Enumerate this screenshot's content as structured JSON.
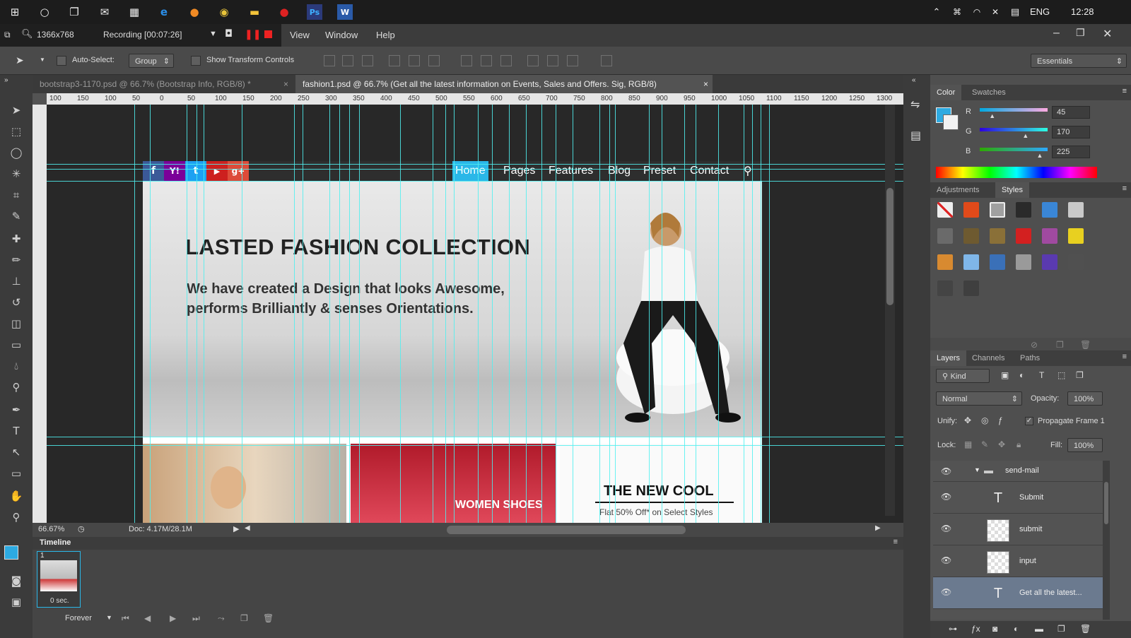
{
  "taskbar": {
    "icons": [
      "windows-icon",
      "cortana-icon",
      "task-view-icon",
      "mail-icon",
      "store-icon",
      "edge-icon",
      "firefox-icon",
      "chrome-icon",
      "explorer-icon",
      "record-icon",
      "photoshop-icon",
      "word-icon"
    ],
    "lang": "ENG",
    "time": "12:28"
  },
  "recorder": {
    "resolution": "1366x768",
    "recording": "Recording [00:07:26]"
  },
  "menu": {
    "items": [
      "View",
      "Window",
      "Help"
    ]
  },
  "options": {
    "auto_select": "Auto-Select:",
    "group": "Group",
    "show_transform": "Show Transform Controls",
    "workspace": "Essentials"
  },
  "tabs": [
    {
      "label": "bootstrap3-1170.psd @ 66.7% (Bootstrap Info, RGB/8) *"
    },
    {
      "label": "fashion1.psd @ 66.7% (Get all the latest information on Events, Sales and Offers. Sig, RGB/8)"
    }
  ],
  "ruler_h": [
    "100",
    "150",
    "100",
    "50",
    "0",
    "50",
    "100",
    "150",
    "200",
    "250",
    "300",
    "350",
    "400",
    "450",
    "500",
    "550",
    "600",
    "650",
    "700",
    "750",
    "800",
    "850",
    "900",
    "950",
    "1000",
    "1050",
    "1100",
    "1150",
    "1200",
    "1250",
    "1300"
  ],
  "design": {
    "nav": [
      "Home",
      "Pages",
      "Features",
      "Blog",
      "Preset",
      "Contact"
    ],
    "social": [
      "f",
      "Y!",
      "t",
      "▶",
      "g+"
    ],
    "hero_title": "LASTED FASHION COLLECTION",
    "hero_line1": "We have created a Design that looks Awesome,",
    "hero_line2": "performs Brilliantly & senses Orientations.",
    "promo_shoes": "WOMEN SHOES",
    "promo_cool": "THE NEW COOL",
    "promo_cool_sub": "Flat 50% Off* on Select Styles"
  },
  "status": {
    "zoom": "66.67%",
    "doc": "Doc: 4.17M/28.1M"
  },
  "timeline": {
    "title": "Timeline",
    "frame_num": "1",
    "frame_delay": "0 sec.",
    "loop": "Forever"
  },
  "color_panel": {
    "tabs": [
      "Color",
      "Swatches"
    ],
    "r": "45",
    "g": "170",
    "b": "225",
    "r_frac": 0.18,
    "g_frac": 0.67,
    "b_frac": 0.88,
    "fg_color": "#2daae1"
  },
  "styles_panel": {
    "tabs": [
      "Adjustments",
      "Styles"
    ],
    "swatches": [
      "#d8d8d8",
      "#e14a1a",
      "#a0a0a0",
      "#2a2a2a",
      "#3a86d6",
      "#c9c9c9",
      "#6a6a6a",
      "#6e5a30",
      "#8a7038",
      "#d32020",
      "#a04aa0",
      "#e8d020",
      "#d88a30",
      "#7fb6e8",
      "#3a70b8",
      "#9a9a9a",
      "#5a3ab0",
      "#505050",
      "#444444",
      "#3f3f3f"
    ]
  },
  "layers_panel": {
    "tabs": [
      "Layers",
      "Channels",
      "Paths"
    ],
    "kind": "Kind",
    "blend": "Normal",
    "opacity_label": "Opacity:",
    "opacity": "100%",
    "unify": "Unify:",
    "propagate": "Propagate Frame 1",
    "lock": "Lock:",
    "fill_label": "Fill:",
    "fill": "100%",
    "group": "send-mail",
    "layers": [
      {
        "name": "Submit",
        "type": "text"
      },
      {
        "name": "submit",
        "type": "raster"
      },
      {
        "name": "input",
        "type": "raster"
      },
      {
        "name": "Get all the latest...",
        "type": "text"
      }
    ]
  }
}
